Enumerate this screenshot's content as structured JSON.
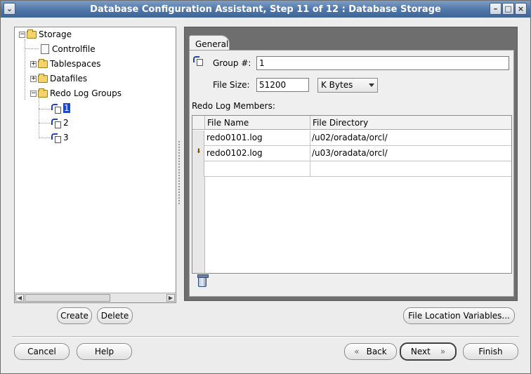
{
  "window": {
    "title": "Database Configuration Assistant, Step 11 of 12 : Database Storage",
    "menu_glyph": "⌄",
    "min_glyph": "–",
    "max_glyph": "□",
    "close_glyph": "×"
  },
  "tree": {
    "root": "Storage",
    "controlfile": "Controlfile",
    "tablespaces": "Tablespaces",
    "datafiles": "Datafiles",
    "redo_log_groups": "Redo Log Groups",
    "groups": [
      "1",
      "2",
      "3"
    ],
    "selected_group": "1"
  },
  "left_buttons": {
    "create": "Create",
    "delete": "Delete"
  },
  "tab": {
    "general": "General"
  },
  "form": {
    "group_label": "Group #:",
    "group_value": "1",
    "file_size_label": "File Size:",
    "file_size_value": "51200",
    "unit_selected": "K Bytes",
    "members_label": "Redo Log Members:"
  },
  "grid": {
    "columns": [
      "File Name",
      "File Directory"
    ],
    "rows": [
      {
        "file_name": "redo0101.log",
        "file_directory": "/u02/oradata/orcl/"
      },
      {
        "file_name": "redo0102.log",
        "file_directory": "/u03/oradata/orcl/"
      },
      {
        "file_name": "",
        "file_directory": ""
      }
    ]
  },
  "buttons": {
    "file_location_variables": "File Location Variables...",
    "cancel": "Cancel",
    "help": "Help",
    "back": "Back",
    "next": "Next",
    "finish": "Finish"
  }
}
